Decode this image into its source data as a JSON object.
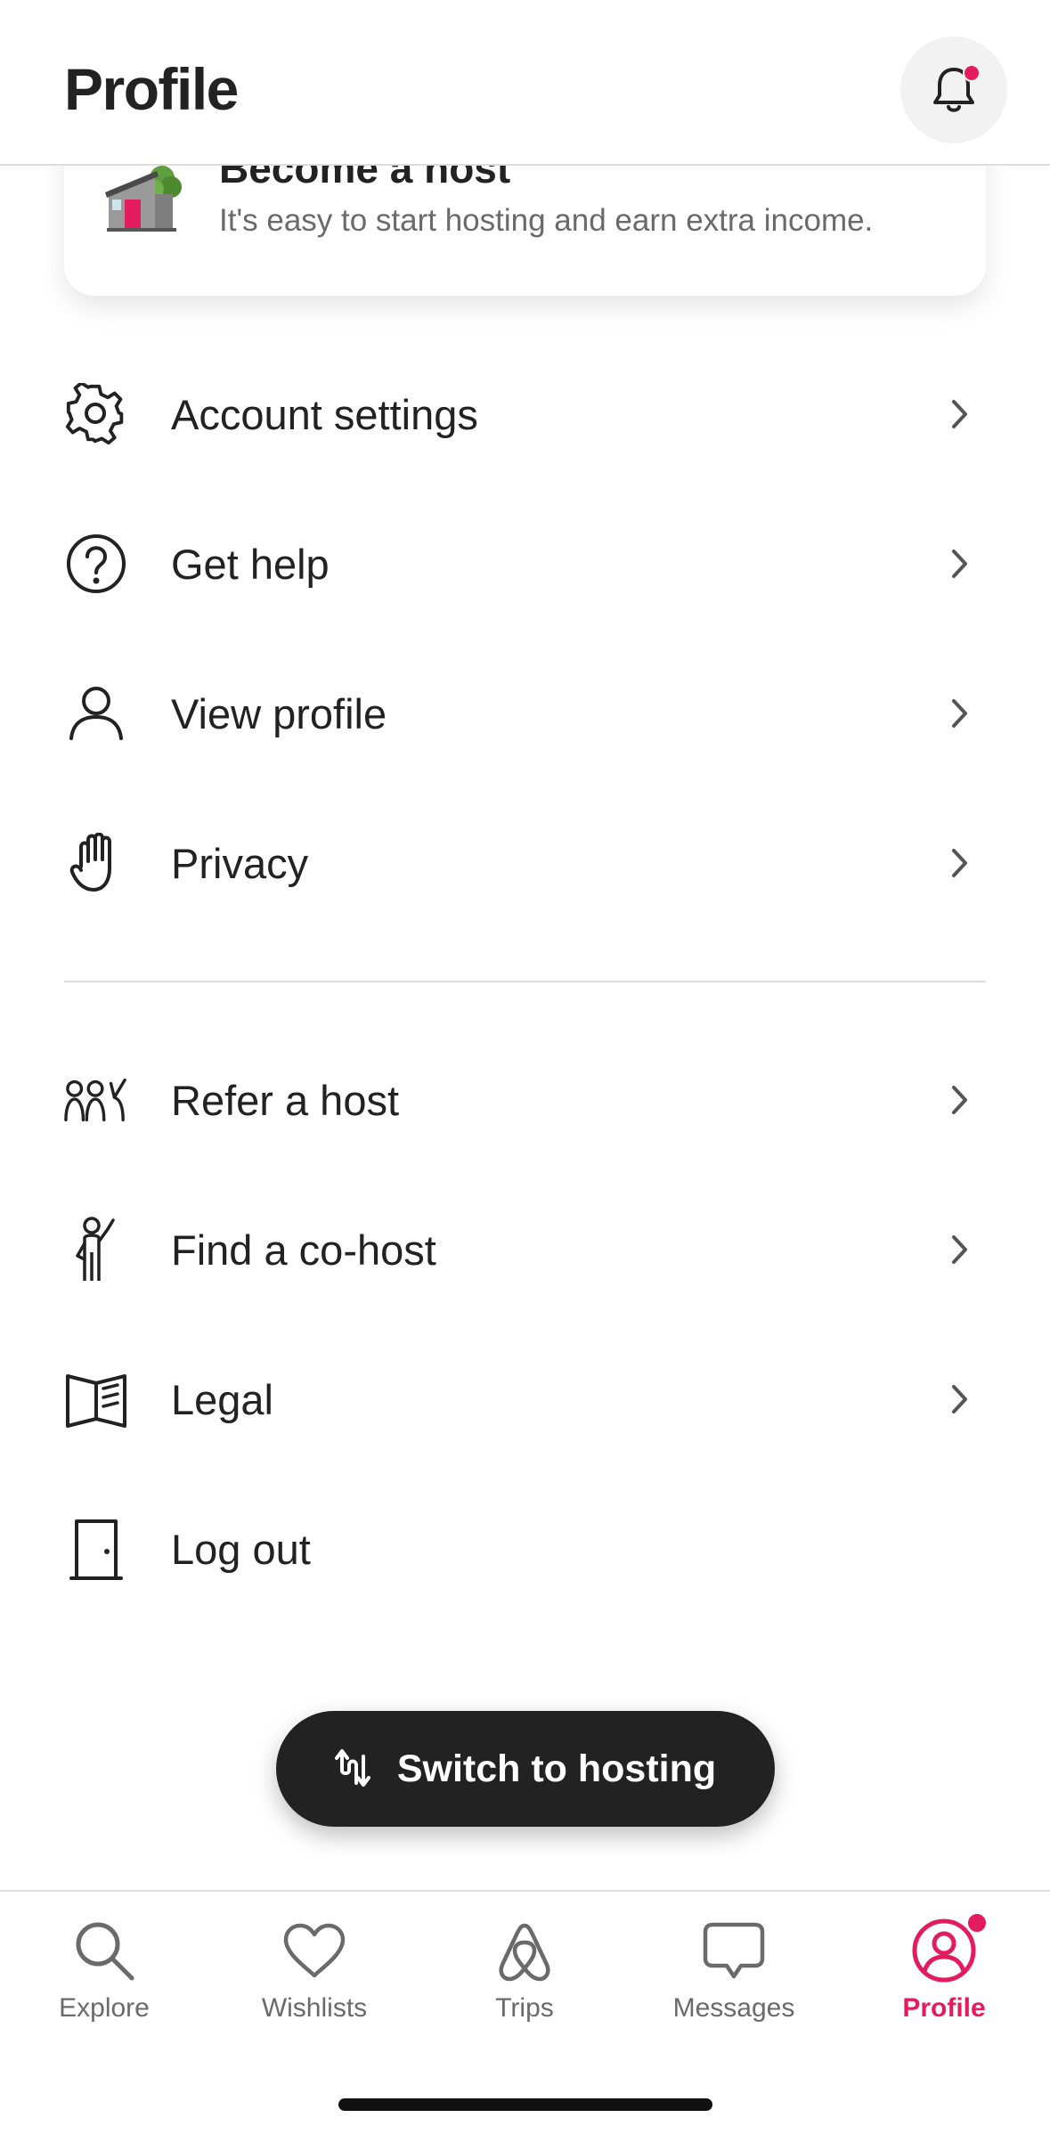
{
  "header": {
    "title": "Profile",
    "notification_icon": "bell-icon",
    "has_notification": true
  },
  "host_card": {
    "title": "Become a host",
    "subtitle": "It's easy to start hosting and earn extra income."
  },
  "menu": {
    "section1": [
      {
        "label": "Account settings",
        "icon": "gear-icon"
      },
      {
        "label": "Get help",
        "icon": "question-circle-icon"
      },
      {
        "label": "View profile",
        "icon": "person-icon"
      },
      {
        "label": "Privacy",
        "icon": "hand-icon"
      }
    ],
    "section2": [
      {
        "label": "Refer a host",
        "icon": "people-icon"
      },
      {
        "label": "Find a co-host",
        "icon": "co-host-person-icon"
      },
      {
        "label": "Legal",
        "icon": "book-icon"
      },
      {
        "label": "Log out",
        "icon": "door-icon"
      }
    ]
  },
  "switch_button": {
    "label": "Switch to hosting",
    "icon": "switch-arrows-icon"
  },
  "tabbar": {
    "tabs": [
      {
        "label": "Explore",
        "icon": "search-icon"
      },
      {
        "label": "Wishlists",
        "icon": "heart-icon"
      },
      {
        "label": "Trips",
        "icon": "airbnb-logo-icon"
      },
      {
        "label": "Messages",
        "icon": "message-bubble-icon"
      },
      {
        "label": "Profile",
        "icon": "profile-circle-icon",
        "active": true
      }
    ]
  },
  "colors": {
    "accent": "#e31c5f",
    "text": "#222222",
    "muted": "#6a6a6a",
    "divider": "#dddddd",
    "dark_button": "#222222"
  }
}
